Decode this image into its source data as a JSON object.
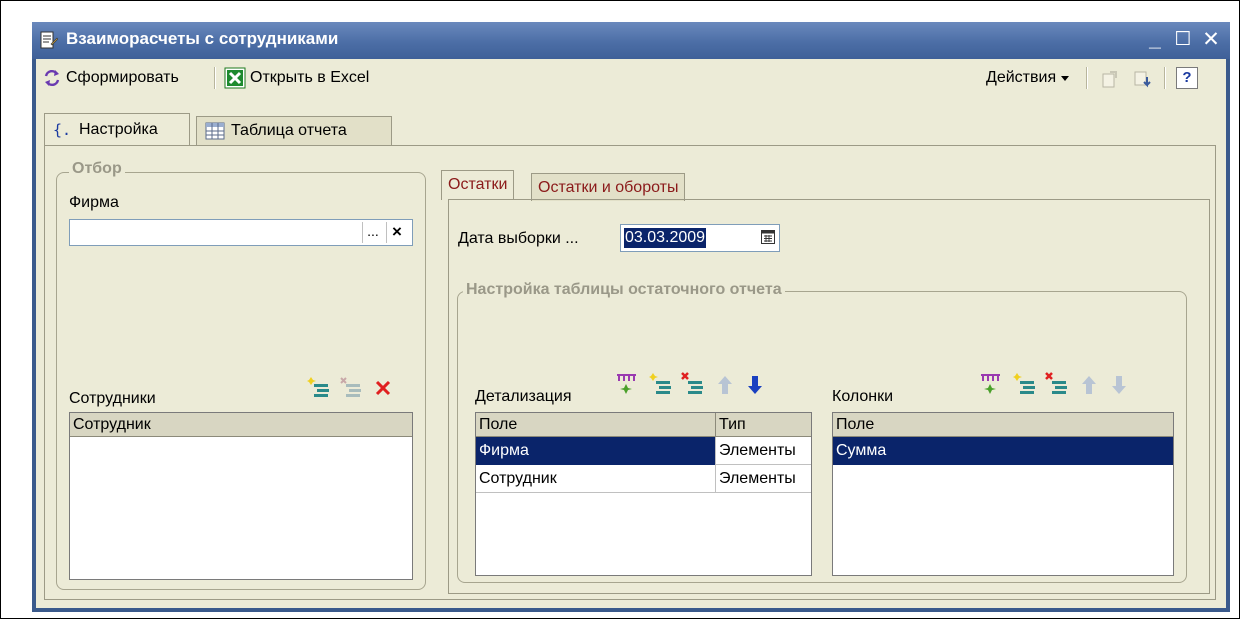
{
  "window": {
    "title": "Взаиморасчеты с сотрудниками",
    "minimize": "_",
    "maximize": "☐",
    "close": "✕"
  },
  "toolbar": {
    "generate": "Сформировать",
    "excel": "Открыть в Excel",
    "actions": "Действия",
    "help": "?"
  },
  "tabs": [
    {
      "label": "Настройка"
    },
    {
      "label": "Таблица отчета"
    }
  ],
  "filter": {
    "group_title": "Отбор",
    "firm_label": "Фирма",
    "firm_value": "",
    "select_btn": "...",
    "clear_btn": "×",
    "employees_label": "Сотрудники",
    "employees_column": "Сотрудник"
  },
  "subtabs": [
    {
      "label": "Остатки"
    },
    {
      "label": "Остатки и обороты"
    }
  ],
  "balances": {
    "date_label": "Дата выборки ...",
    "date_value": "03.03.2009",
    "group_title": "Настройка таблицы остаточного отчета",
    "detail_label": "Детализация",
    "detail_columns": [
      "Поле",
      "Тип"
    ],
    "detail_rows": [
      {
        "field": "Фирма",
        "type": "Элементы"
      },
      {
        "field": "Сотрудник",
        "type": "Элементы"
      }
    ],
    "columns_label": "Колонки",
    "columns_header": "Поле",
    "columns_rows": [
      {
        "field": "Сумма"
      }
    ]
  }
}
